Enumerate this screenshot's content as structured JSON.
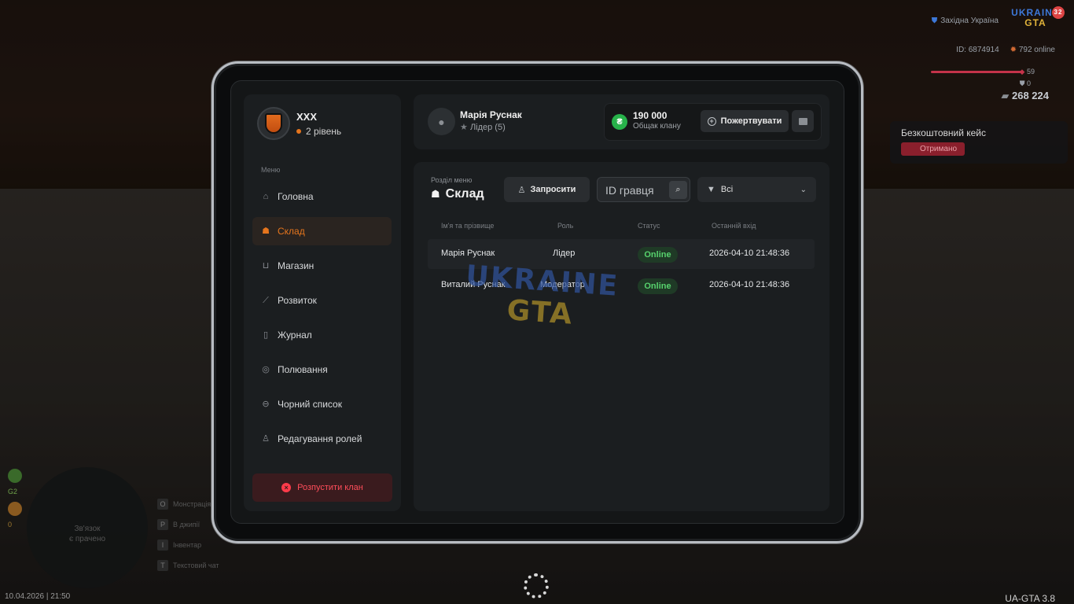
{
  "hud": {
    "region": "Західна Україна",
    "logo_top": "UKRAINE",
    "logo_bottom": "GTA",
    "logo_badge": "32",
    "player_id": "ID: 6874914",
    "online": "792 online",
    "health": "59",
    "armor": "0",
    "money": "268 224",
    "free_case_title": "Безкоштовний кейс",
    "free_case_status": "Отримано",
    "minimap_text_1": "Зв'язок",
    "minimap_text_2": "є прачено",
    "keys": [
      {
        "key": "O",
        "label": "Монстрація"
      },
      {
        "key": "P",
        "label": "В джипії"
      },
      {
        "key": "I",
        "label": "Інвентар"
      },
      {
        "key": "T",
        "label": "Текстовий чат"
      }
    ],
    "stat_g2": "G2",
    "stat_zero": "0",
    "datetime": "10.04.2026 | 21:50",
    "version": "UA-GTA 3.8"
  },
  "clan": {
    "name": "XXX",
    "level": "2 рівень"
  },
  "menu": {
    "title": "Меню",
    "items": [
      {
        "label": "Головна",
        "icon": "home-icon",
        "glyph": "⌂",
        "active": false
      },
      {
        "label": "Склад",
        "icon": "members-icon",
        "glyph": "☗",
        "active": true
      },
      {
        "label": "Магазин",
        "icon": "basket-icon",
        "glyph": "⊔",
        "active": false
      },
      {
        "label": "Розвиток",
        "icon": "chart-icon",
        "glyph": "⟋",
        "active": false
      },
      {
        "label": "Журнал",
        "icon": "book-icon",
        "glyph": "▯",
        "active": false
      },
      {
        "label": "Полювання",
        "icon": "target-icon",
        "glyph": "◎",
        "active": false
      },
      {
        "label": "Чорний список",
        "icon": "block-icon",
        "glyph": "⊖",
        "active": false
      },
      {
        "label": "Редагування ролей",
        "icon": "user-edit-icon",
        "glyph": "♙",
        "active": false
      }
    ],
    "disband_label": "Розпустити клан"
  },
  "user": {
    "name": "Марія Руснак",
    "role": "Лідер (5)"
  },
  "bank": {
    "amount": "190 000",
    "label": "Общак клану",
    "donate_label": "Пожертвувати"
  },
  "section": {
    "subtitle": "Розділ меню",
    "title": "Склад",
    "invite_label": "Запросити",
    "search_placeholder": "ID гравця",
    "filter_value": "Всі"
  },
  "table": {
    "headers": [
      "Ім'я та прізвище",
      "Роль",
      "Статус",
      "Останній вхід"
    ],
    "rows": [
      {
        "name": "Марія Руснак",
        "role": "Лідер",
        "status": "Online",
        "last": "2026-04-10 21:48:36"
      },
      {
        "name": "Виталий Руснак",
        "role": "Модератор",
        "status": "Online",
        "last": "2026-04-10 21:48:36"
      }
    ]
  },
  "watermark": {
    "top": "UKRAINE",
    "bottom": "GTA"
  },
  "colors": {
    "accent": "#e5751d",
    "online": "#57d26d",
    "danger": "#ff3b4a",
    "bank_icon": "#27b24a"
  }
}
